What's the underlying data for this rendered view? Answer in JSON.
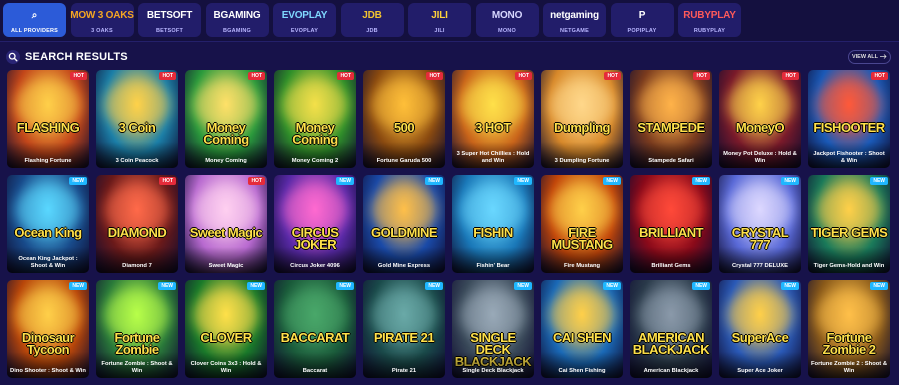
{
  "providers": [
    {
      "logo": "⌕",
      "label": "ALL PROVIDERS",
      "active": true,
      "color": "#ffffff"
    },
    {
      "logo": "MOW 3 OAKS",
      "label": "3 OAKS",
      "active": false,
      "color": "#f5a623"
    },
    {
      "logo": "BETSOFT",
      "label": "BETSOFT",
      "active": false,
      "color": "#ffffff"
    },
    {
      "logo": "BGAMING",
      "label": "BGAMING",
      "active": false,
      "color": "#ffffff"
    },
    {
      "logo": "EVOPLAY",
      "label": "EVOPLAY",
      "active": false,
      "color": "#7fd8ff"
    },
    {
      "logo": "JDB",
      "label": "JDB",
      "active": false,
      "color": "#f2c230"
    },
    {
      "logo": "JILI",
      "label": "JILI",
      "active": false,
      "color": "#ffd23a"
    },
    {
      "logo": "MONO",
      "label": "MONO",
      "active": false,
      "color": "#d7d7ff"
    },
    {
      "logo": "netgaming",
      "label": "NETGAME",
      "active": false,
      "color": "#ffffff"
    },
    {
      "logo": "P",
      "label": "POPIPLAY",
      "active": false,
      "color": "#ffffff"
    },
    {
      "logo": "RUBYPLAY",
      "label": "RUBYPLAY",
      "active": false,
      "color": "#ff5a5a"
    }
  ],
  "section": {
    "title": "SEARCH RESULTS",
    "view_all": "VIEW ALL"
  },
  "games": [
    {
      "title": "FLASHING",
      "caption": "Flashing Fortune",
      "badge": "HOT",
      "bg": "#c2461a",
      "glow": "#ffd04a"
    },
    {
      "title": "3 Coin",
      "caption": "3 Coin Peacock",
      "badge": "HOT",
      "bg": "#1b7fa8",
      "glow": "#ffd24a"
    },
    {
      "title": "Money Coming",
      "caption": "Money Coming",
      "badge": "HOT",
      "bg": "#2a9a3c",
      "glow": "#ffe169"
    },
    {
      "title": "Money Coming",
      "caption": "Money Coming 2",
      "badge": "HOT",
      "bg": "#2f8f2a",
      "glow": "#f4e04a"
    },
    {
      "title": "500",
      "caption": "Fortune Garuda 500",
      "badge": "HOT",
      "bg": "#8a4a10",
      "glow": "#ffbf3a"
    },
    {
      "title": "3 HOT",
      "caption": "3 Super Hot Chillies : Hold and Win",
      "badge": "HOT",
      "bg": "#c9641a",
      "glow": "#ffe14a"
    },
    {
      "title": "Dumpling",
      "caption": "3 Dumpling Fortune",
      "badge": "HOT",
      "bg": "#d8892a",
      "glow": "#ffd88a"
    },
    {
      "title": "STAMPEDE",
      "caption": "Stampede Safari",
      "badge": "HOT",
      "bg": "#7a3b1e",
      "glow": "#ffb24a"
    },
    {
      "title": "MoneyO",
      "caption": "Money Pot Deluxe : Hold & Win",
      "badge": "HOT",
      "bg": "#7a1a2a",
      "glow": "#ffd24a"
    },
    {
      "title": "FISHOOTER",
      "caption": "Jackpot Fishooter : Shoot & Win",
      "badge": "HOT",
      "bg": "#1a5ab8",
      "glow": "#ff5a3a"
    },
    {
      "title": "Ocean King",
      "caption": "Ocean King Jackpot : Shoot & Win",
      "badge": "NEW",
      "bg": "#184a8a",
      "glow": "#5ad8ff"
    },
    {
      "title": "DIAMOND",
      "caption": "Diamond 7",
      "badge": "HOT",
      "bg": "#6a1a1a",
      "glow": "#ff6a4a"
    },
    {
      "title": "Sweet Magic",
      "caption": "Sweet Magic",
      "badge": "HOT",
      "bg": "#b86ad0",
      "glow": "#ffd0f0"
    },
    {
      "title": "CIRCUS JOKER",
      "caption": "Circus Joker 4096",
      "badge": "NEW",
      "bg": "#5a2aa8",
      "glow": "#ff6ad0"
    },
    {
      "title": "GOLDMINE",
      "caption": "Gold Mine Express",
      "badge": "NEW",
      "bg": "#1a4aa8",
      "glow": "#ffc04a"
    },
    {
      "title": "FISHIN",
      "caption": "Fishin' Bear",
      "badge": "NEW",
      "bg": "#1a78b8",
      "glow": "#6ad8ff"
    },
    {
      "title": "FIRE MUSTANG",
      "caption": "Fire Mustang",
      "badge": "NEW",
      "bg": "#c2460a",
      "glow": "#ffd04a"
    },
    {
      "title": "BRILLIANT",
      "caption": "Brilliant Gems",
      "badge": "NEW",
      "bg": "#8a0a1a",
      "glow": "#ff4a3a"
    },
    {
      "title": "CRYSTAL 777",
      "caption": "Crystal 777 DELUXE",
      "badge": "NEW",
      "bg": "#5a6ad8",
      "glow": "#dcd8ff"
    },
    {
      "title": "TIGER GEMS",
      "caption": "Tiger Gems-Hold and Win",
      "badge": "NEW",
      "bg": "#1a7a5a",
      "glow": "#ffd04a"
    },
    {
      "title": "Dinosaur Tycoon",
      "caption": "Dino Shooter : Shoot & Win",
      "badge": "NEW",
      "bg": "#b8460a",
      "glow": "#ffd04a"
    },
    {
      "title": "Fortune Zombie",
      "caption": "Fortune Zombie : Shoot & Win",
      "badge": "NEW",
      "bg": "#2a7a3a",
      "glow": "#b8ff4a"
    },
    {
      "title": "CLOVER",
      "caption": "Clover Coins 3x3 : Hold & Win",
      "badge": "NEW",
      "bg": "#1a7a2a",
      "glow": "#ffe04a"
    },
    {
      "title": "BACCARAT",
      "caption": "Baccarat",
      "badge": "NEW",
      "bg": "#1a5a3a",
      "glow": "#4aa86a"
    },
    {
      "title": "PIRATE 21",
      "caption": "Pirate 21",
      "badge": "NEW",
      "bg": "#1a4a4a",
      "glow": "#6aaaa8"
    },
    {
      "title": "SINGLE DECK BLACKJACK",
      "caption": "Single Deck Blackjack",
      "badge": "NEW",
      "bg": "#3a4a5a",
      "glow": "#9aaab8"
    },
    {
      "title": "CAI SHEN",
      "caption": "Cai Shen Fishing",
      "badge": "NEW",
      "bg": "#1a6ab8",
      "glow": "#ffd04a"
    },
    {
      "title": "AMERICAN BLACKJACK",
      "caption": "American Blackjack",
      "badge": "NEW",
      "bg": "#2a3a4a",
      "glow": "#8a9aaa"
    },
    {
      "title": "SuperAce",
      "caption": "Super Ace Joker",
      "badge": "NEW",
      "bg": "#2a5ab8",
      "glow": "#ffd04a"
    },
    {
      "title": "Fortune Zombie 2",
      "caption": "Fortune Zombie 2 : Shoot & Win",
      "badge": "NEW",
      "bg": "#8a5a1a",
      "glow": "#ffc04a"
    }
  ]
}
